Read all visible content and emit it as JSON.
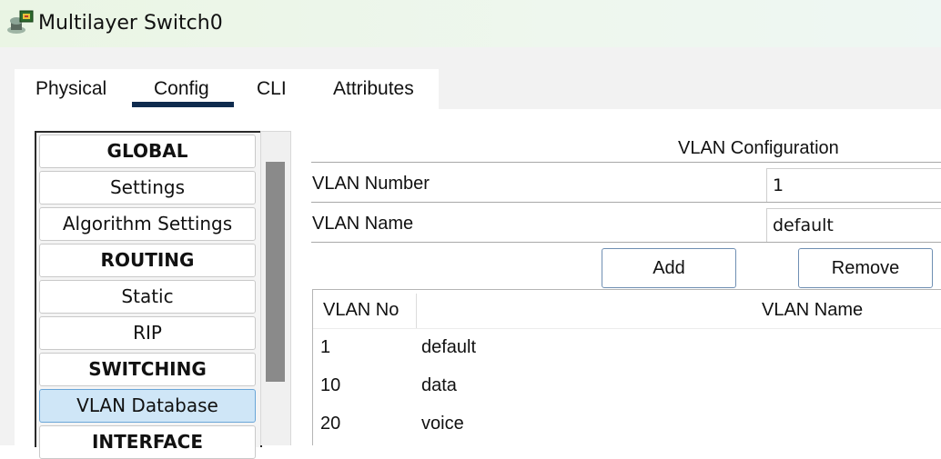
{
  "window": {
    "title": "Multilayer Switch0",
    "icon": "multilayer-switch-icon"
  },
  "tabs": [
    {
      "label": "Physical",
      "active": false
    },
    {
      "label": "Config",
      "active": true
    },
    {
      "label": "CLI",
      "active": false
    },
    {
      "label": "Attributes",
      "active": false
    }
  ],
  "nav": {
    "items": [
      {
        "label": "GLOBAL",
        "type": "header"
      },
      {
        "label": "Settings",
        "type": "item"
      },
      {
        "label": "Algorithm Settings",
        "type": "item"
      },
      {
        "label": "ROUTING",
        "type": "header"
      },
      {
        "label": "Static",
        "type": "item"
      },
      {
        "label": "RIP",
        "type": "item"
      },
      {
        "label": "SWITCHING",
        "type": "header"
      },
      {
        "label": "VLAN Database",
        "type": "item",
        "selected": true
      },
      {
        "label": "INTERFACE",
        "type": "header"
      }
    ]
  },
  "vlan_config": {
    "title": "VLAN Configuration",
    "number_label": "VLAN Number",
    "number_value": "1",
    "name_label": "VLAN Name",
    "name_value": "default",
    "add_label": "Add",
    "remove_label": "Remove"
  },
  "vlan_table": {
    "headers": [
      "VLAN No",
      "VLAN Name"
    ],
    "rows": [
      {
        "no": "1",
        "name": "default"
      },
      {
        "no": "10",
        "name": "data"
      },
      {
        "no": "20",
        "name": "voice"
      }
    ]
  },
  "colors": {
    "selected_nav": "#cfe6f7",
    "tab_underline": "#0f2b4e",
    "title_bar": "#eaf5e4"
  }
}
